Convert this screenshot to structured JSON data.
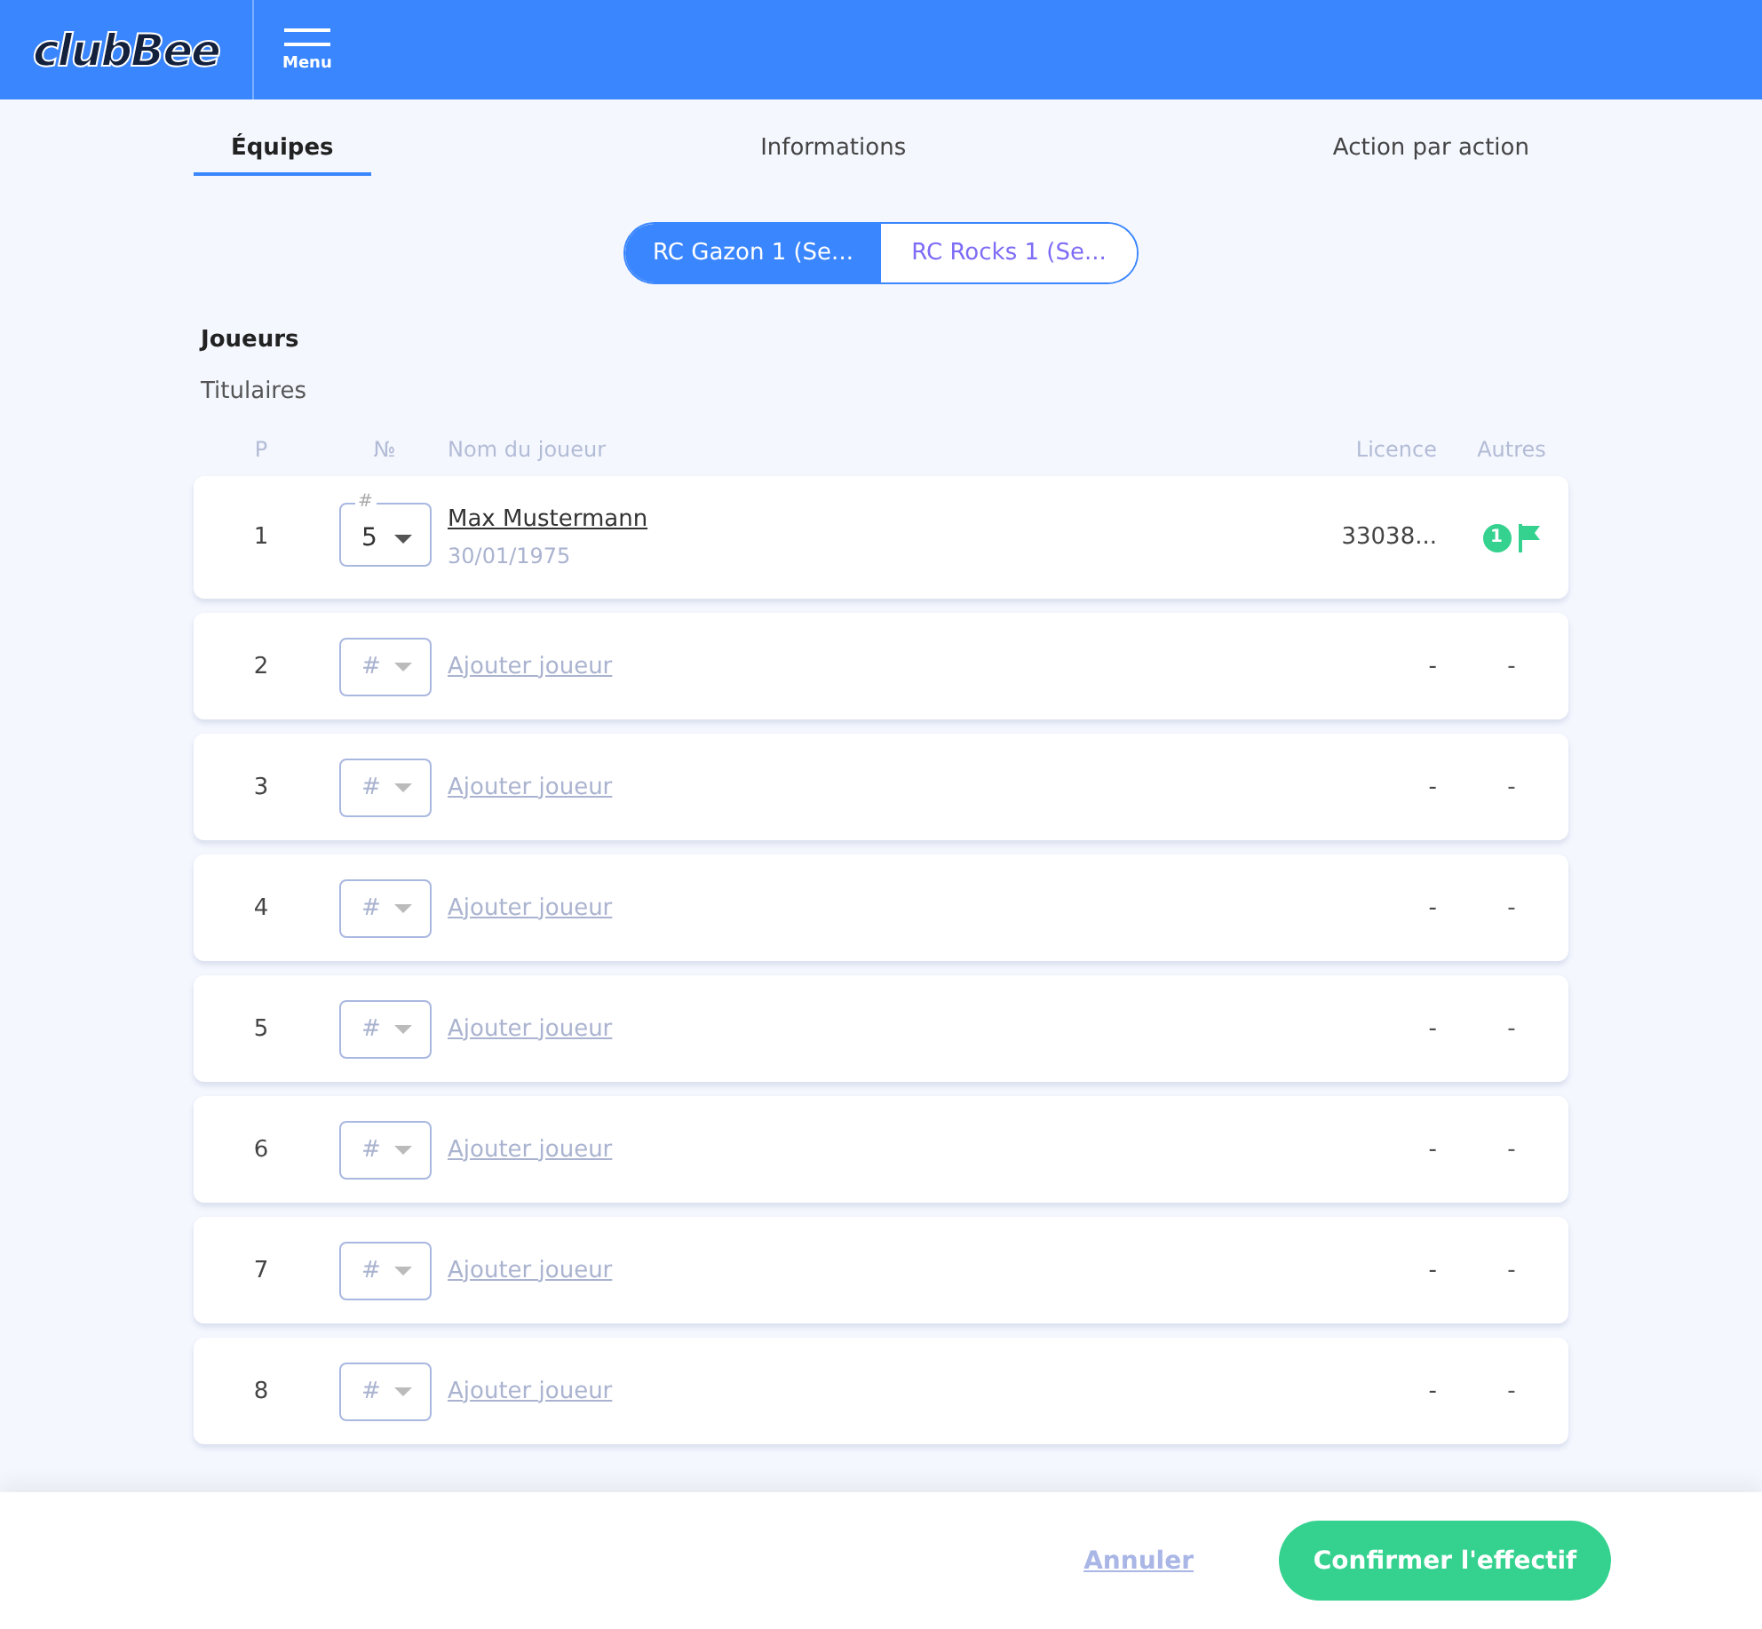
{
  "header": {
    "logo": "clubBee",
    "menu_label": "Menu"
  },
  "tabs": [
    {
      "label": "Équipes",
      "selected": true
    },
    {
      "label": "Informations",
      "selected": false
    },
    {
      "label": "Action par action",
      "selected": false
    }
  ],
  "team_switch": [
    {
      "label": "RC Gazon 1 (Se...",
      "selected": true
    },
    {
      "label": "RC Rocks 1 (Se...",
      "selected": false
    }
  ],
  "section_title": "Joueurs",
  "group_title": "Titulaires",
  "columns": {
    "p": "P",
    "number": "№",
    "name": "Nom du joueur",
    "licence": "Licence",
    "others": "Autres"
  },
  "rows": [
    {
      "kind": "player",
      "p": "1",
      "number_label": "#",
      "number": "5",
      "name": "Max Mustermann",
      "date": "30/01/1975",
      "licence": "33038...",
      "badge": "1"
    },
    {
      "kind": "empty",
      "p": "2",
      "placeholder": "#",
      "name": "Ajouter joueur",
      "licence": "-",
      "others": "-"
    },
    {
      "kind": "empty",
      "p": "3",
      "placeholder": "#",
      "name": "Ajouter joueur",
      "licence": "-",
      "others": "-"
    },
    {
      "kind": "empty",
      "p": "4",
      "placeholder": "#",
      "name": "Ajouter joueur",
      "licence": "-",
      "others": "-"
    },
    {
      "kind": "empty",
      "p": "5",
      "placeholder": "#",
      "name": "Ajouter joueur",
      "licence": "-",
      "others": "-"
    },
    {
      "kind": "empty",
      "p": "6",
      "placeholder": "#",
      "name": "Ajouter joueur",
      "licence": "-",
      "others": "-"
    },
    {
      "kind": "empty",
      "p": "7",
      "placeholder": "#",
      "name": "Ajouter joueur",
      "licence": "-",
      "others": "-"
    },
    {
      "kind": "empty",
      "p": "8",
      "placeholder": "#",
      "name": "Ajouter joueur",
      "licence": "-",
      "others": "-"
    }
  ],
  "footer": {
    "cancel": "Annuler",
    "confirm": "Confirmer l'effectif"
  }
}
